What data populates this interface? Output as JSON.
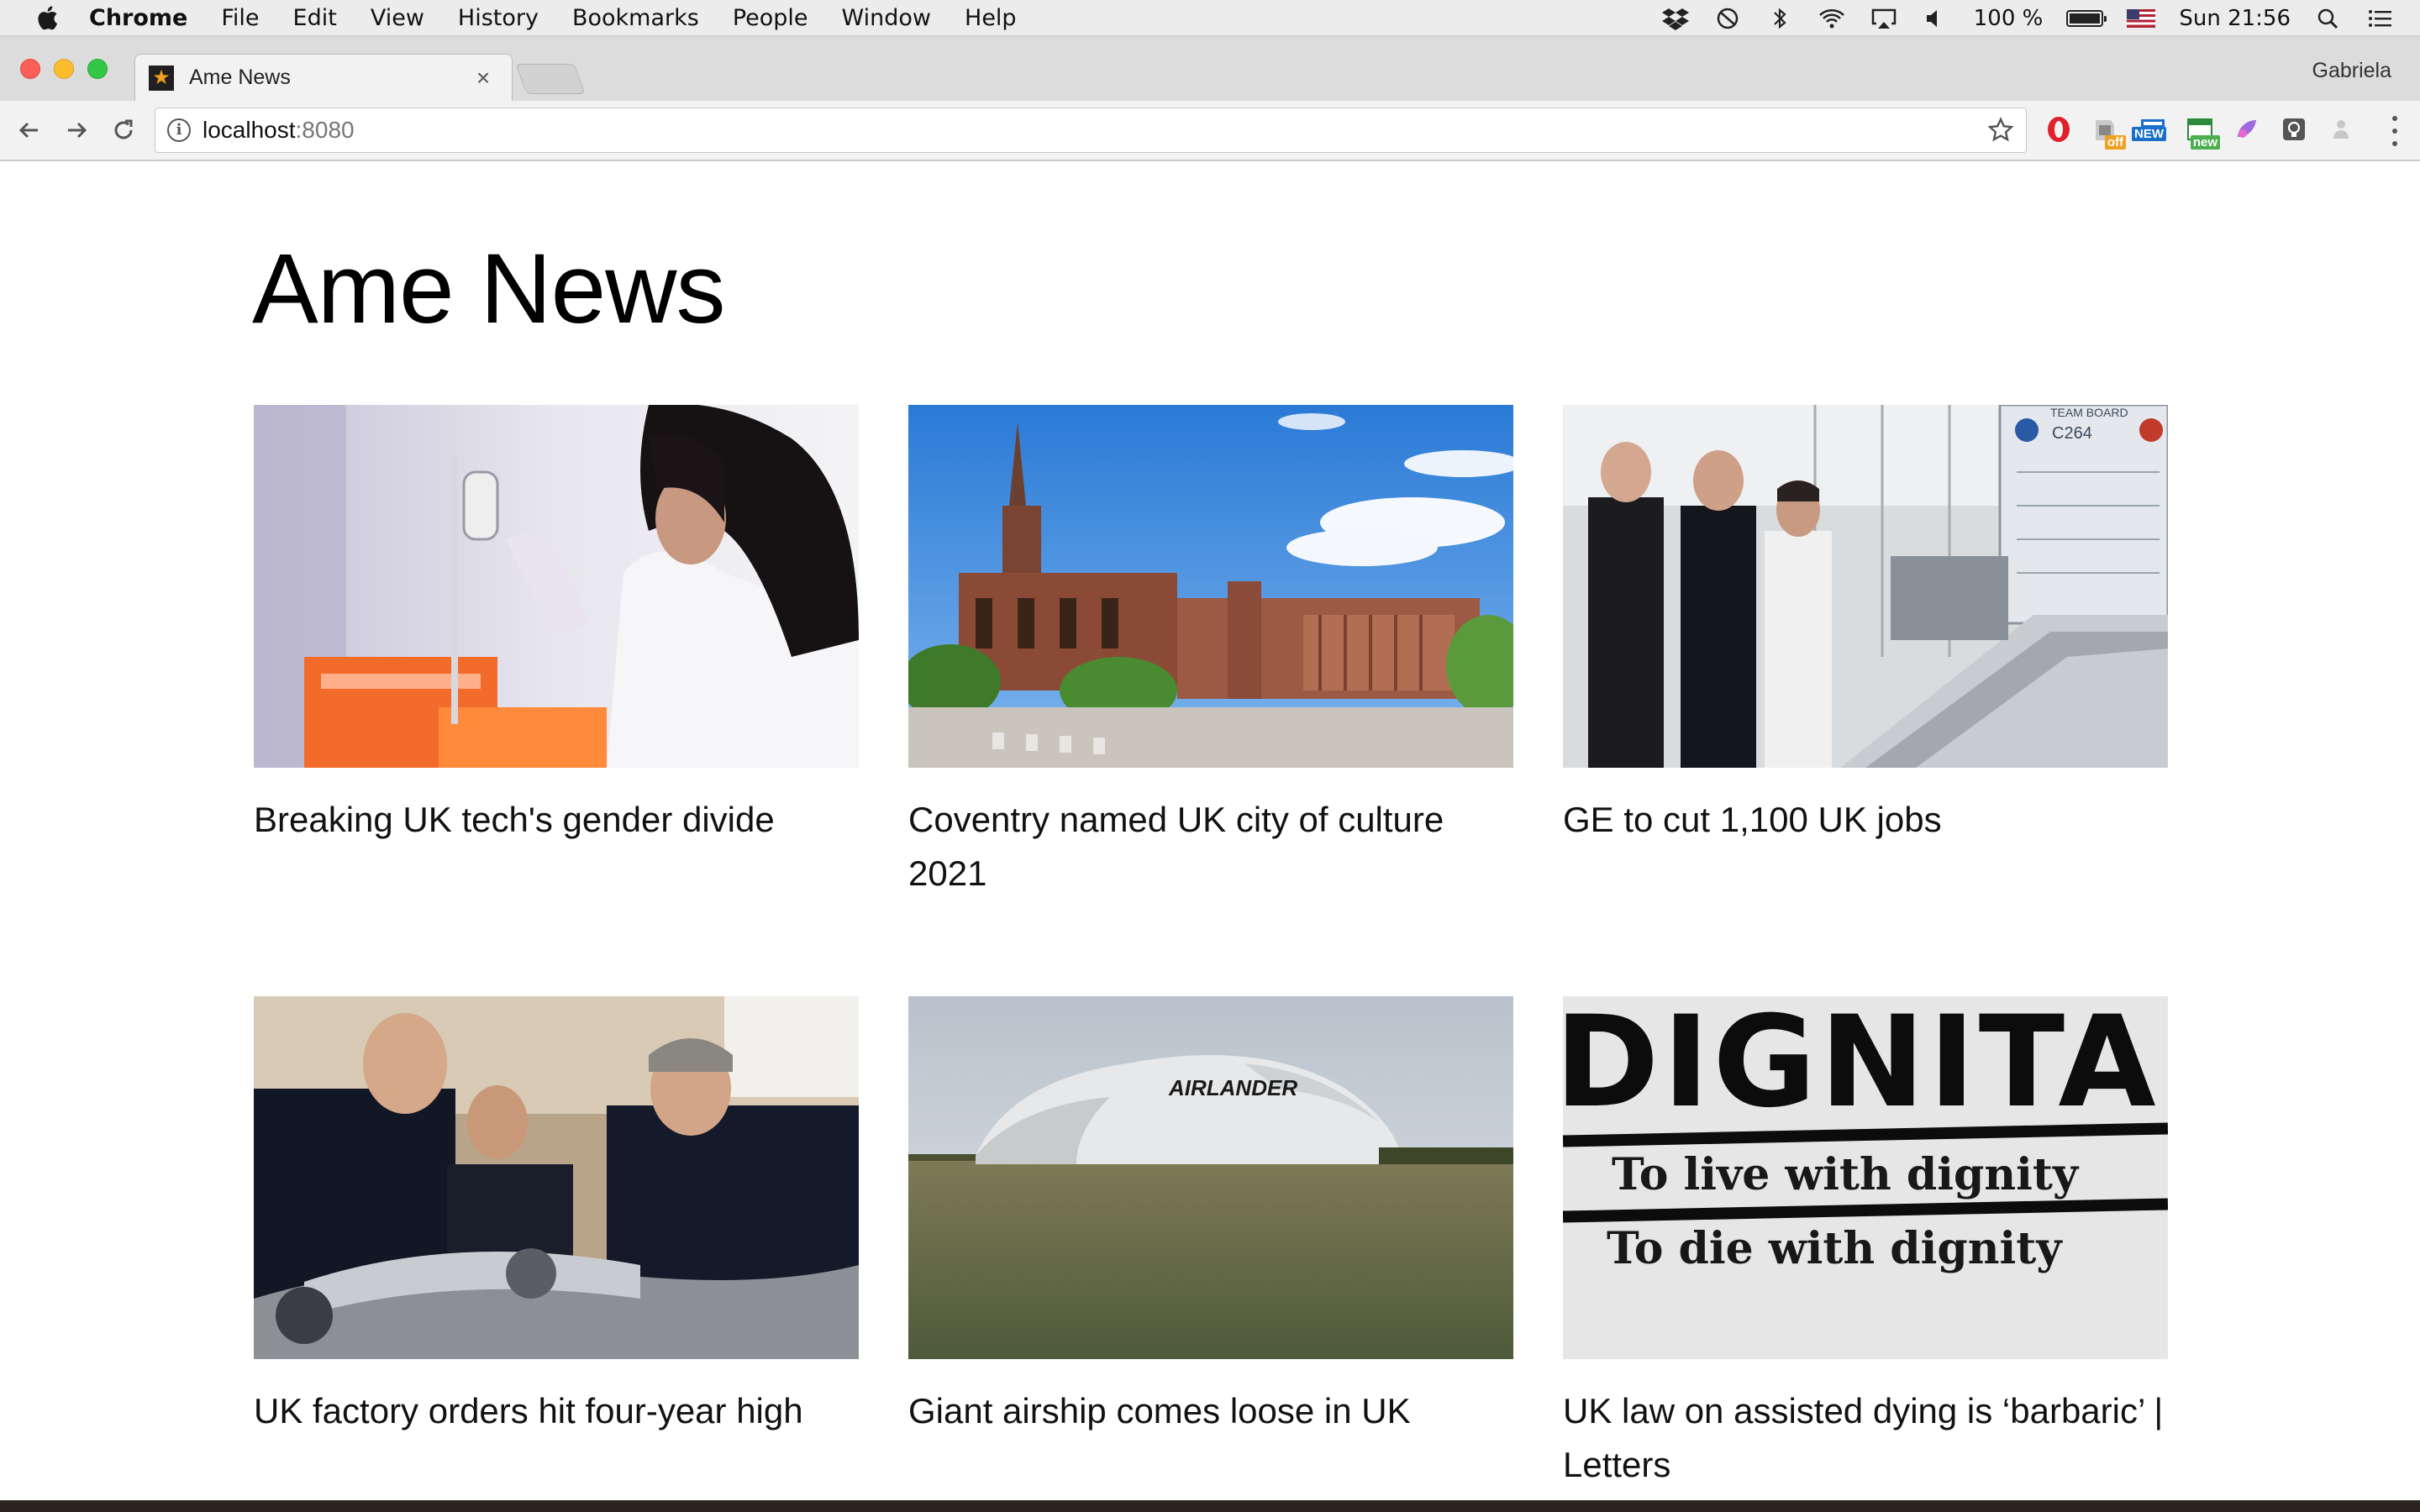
{
  "menubar": {
    "app_name": "Chrome",
    "items": [
      "File",
      "Edit",
      "View",
      "History",
      "Bookmarks",
      "People",
      "Window",
      "Help"
    ],
    "battery_text": "100 %",
    "clock": "Sun 21:56"
  },
  "browser": {
    "tab_title": "Ame News",
    "tab_close": "×",
    "favicon_glyph": "★",
    "profile_name": "Gabriela",
    "url_host": "localhost",
    "url_port": ":8080",
    "extensions": [
      {
        "name": "opera-icon",
        "badge": ""
      },
      {
        "name": "shopping-icon",
        "badge": "off",
        "badge_color": "#f0a020"
      },
      {
        "name": "news-icon",
        "badge": "NEW",
        "badge_color": "#1a6fc9"
      },
      {
        "name": "calendar-icon",
        "badge": "new",
        "badge_color": "#4caf50"
      },
      {
        "name": "color-picker-icon",
        "badge": ""
      },
      {
        "name": "lightbulb-icon",
        "badge": ""
      },
      {
        "name": "user-icon",
        "badge": ""
      }
    ]
  },
  "page": {
    "title": "Ame News",
    "articles": [
      {
        "headline": "Breaking UK tech's gender divide",
        "image": "scientist-pipette"
      },
      {
        "headline": "Coventry named UK city of culture 2021",
        "image": "cathedral"
      },
      {
        "headline": "GE to cut 1,100 UK jobs",
        "image": "factory-visit"
      },
      {
        "headline": "UK factory orders hit four-year high",
        "image": "factory-workers"
      },
      {
        "headline": "Giant airship comes loose in UK",
        "image": "airship"
      },
      {
        "headline": "UK law on assisted dying is ‘barbaric’ | Letters",
        "image": "dignitas-sign"
      }
    ],
    "image_text": {
      "airship_lettering": "AIRLANDER",
      "sign_line1": "DIGNITAS",
      "sign_line2": "To live with dignity",
      "sign_line3": "To die with dignity",
      "board_label": "TEAM BOARD",
      "board_code": "C264"
    }
  },
  "colors": {
    "menubar_bg": "#ececec",
    "tab_strip_bg": "#dcdcdc",
    "toolbar_bg": "#f2f2f2",
    "page_bg": "#ffffff",
    "text": "#111111"
  }
}
